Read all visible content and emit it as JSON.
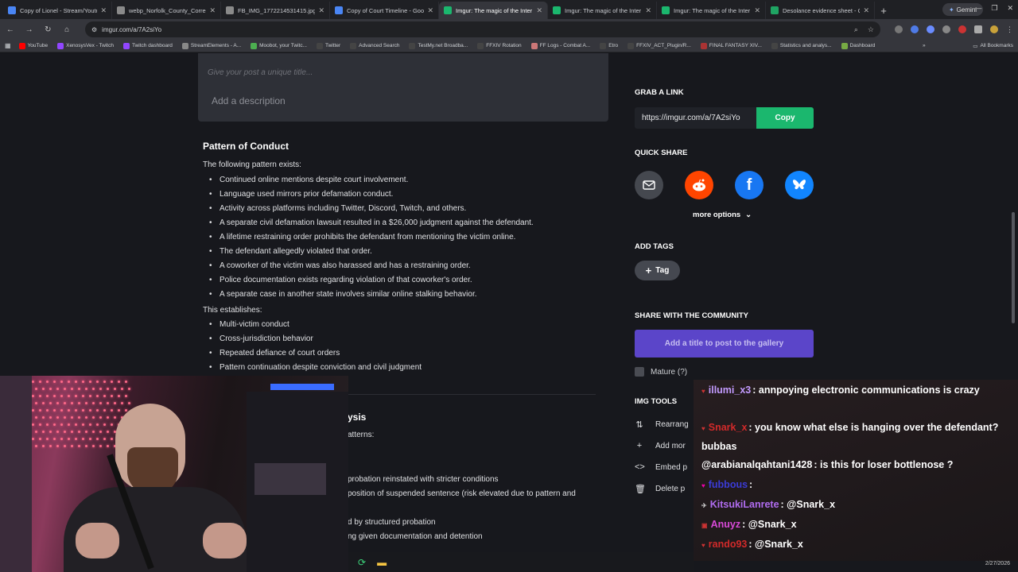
{
  "tabs": [
    {
      "title": "Copy of Lionel - Stream/Youtu",
      "color": "#4a86f5"
    },
    {
      "title": "webp_Norfolk_County_Correc",
      "color": "#8a8a8a"
    },
    {
      "title": "FB_IMG_1772214531415.jpg (",
      "color": "#8a8a8a"
    },
    {
      "title": "Copy of Court Timeline - Goo",
      "color": "#4a86f5"
    },
    {
      "title": "Imgur: The magic of the Inter",
      "color": "#1bb76e",
      "active": true
    },
    {
      "title": "Imgur: The magic of the Inter",
      "color": "#1bb76e"
    },
    {
      "title": "Imgur: The magic of the Inter",
      "color": "#1bb76e"
    },
    {
      "title": "Desolance evidence sheet - G",
      "color": "#1fa463"
    }
  ],
  "gemini_label": "Gemini",
  "url": "imgur.com/a/7A2siYo",
  "bookmarks": [
    {
      "label": "YouTube",
      "color": "#ff0000"
    },
    {
      "label": "XenosysVex - Twitch",
      "color": "#9146ff"
    },
    {
      "label": "Twitch dashboard",
      "color": "#9146ff"
    },
    {
      "label": "StreamElements - A...",
      "color": "#888"
    },
    {
      "label": "Moobot, your Twitc...",
      "color": "#4caf50"
    },
    {
      "label": "Twitter",
      "color": "#444"
    },
    {
      "label": "Advanced Search",
      "color": "#444"
    },
    {
      "label": "TestMy.net Broadba...",
      "color": "#444"
    },
    {
      "label": "FFXIV Rotation",
      "color": "#444"
    },
    {
      "label": "FF Logs - Combat A...",
      "color": "#c77"
    },
    {
      "label": "Etro",
      "color": "#444"
    },
    {
      "label": "FFXIV_ACT_Plugin/R...",
      "color": "#444"
    },
    {
      "label": "FINAL FANTASY XIV...",
      "color": "#a33"
    },
    {
      "label": "Statistics and analys...",
      "color": "#444"
    },
    {
      "label": "Dashboard",
      "color": "#7a4"
    }
  ],
  "all_bookmarks": "All Bookmarks",
  "editor": {
    "title_placeholder": "Give your post a unique title...",
    "description_placeholder": "Add a description"
  },
  "post": {
    "heading": "Pattern of Conduct",
    "intro": "The following pattern exists:",
    "pattern_items": [
      "Continued online mentions despite court involvement.",
      "Language used mirrors prior defamation conduct.",
      "Activity across platforms including Twitter, Discord, Twitch, and others.",
      "A separate civil defamation lawsuit resulted in a $26,000 judgment against the defendant.",
      "A lifetime restraining order prohibits the defendant from mentioning the victim online.",
      "The defendant allegedly violated that order.",
      "A coworker of the victim was also harassed and has a restraining order.",
      "Police documentation exists regarding violation of that coworker's order.",
      "A separate case in another state involves similar online stalking behavior."
    ],
    "establishes": "This establishes:",
    "establish_items": [
      "Multi-victim conduct",
      "Cross-jurisdiction behavior",
      "Repeated defiance of court orders",
      "Pattern continuation despite conviction and civil judgment"
    ]
  },
  "post2": {
    "heading_fragment": "ysis",
    "intro_fragment": "atterns:",
    "lines": [
      "probation reinstated with stricter conditions",
      "position of suspended sentence (risk elevated due to pattern and",
      "d by structured probation",
      "ng given documentation and detention"
    ]
  },
  "side": {
    "grab_link": "GRAB A LINK",
    "link": "https://imgur.com/a/7A2siYo",
    "copy": "Copy",
    "quick_share": "QUICK SHARE",
    "more_options": "more options",
    "add_tags": "ADD TAGS",
    "tag": "Tag",
    "share_community": "SHARE WITH THE COMMUNITY",
    "post_button": "Add a title to post to the gallery",
    "mature": "Mature (?)",
    "img_tools": "IMG TOOLS",
    "tools": [
      "Rearrang",
      "Add mor",
      "Embed p",
      "Delete p"
    ]
  },
  "chat": [
    {
      "user": "illumi_x3",
      "user_color": "#c39bff",
      "text": ": annpoying electronic communications is crazy"
    },
    {
      "user": "Snark_x",
      "user_color": "#d22a2a",
      "text": ": you know what else is hanging over the defendant? bubbas"
    },
    {
      "user": "@arabianalqahtani1428",
      "user_color": "#ffffff",
      "text": ": is this for loser bottlenose ?"
    },
    {
      "user": "fubbous",
      "user_color": "#3b3bd6",
      "text": ":"
    },
    {
      "user": "KitsukiLanrete",
      "user_color": "#b06cf0",
      "text": ": @Snark_x"
    },
    {
      "user": "Anuyz",
      "user_color": "#d94ad9",
      "text": ": @Snark_x"
    },
    {
      "user": "rando93",
      "user_color": "#d22a2a",
      "text": ": @Snark_x"
    }
  ],
  "clock": "2/27/2026",
  "icons": {
    "back": "arrow-left-icon",
    "forward": "arrow-right-icon",
    "reload": "reload-icon",
    "home": "home-icon",
    "email": "mail-icon",
    "reddit": "reddit-icon",
    "facebook": "facebook-icon",
    "bluesky": "bluesky-icon"
  },
  "colors": {
    "imgur_green": "#1bb76e",
    "post_purple": "#5b45c9",
    "reddit": "#ff4500",
    "facebook": "#1877f2",
    "bluesky": "#1185fe"
  }
}
